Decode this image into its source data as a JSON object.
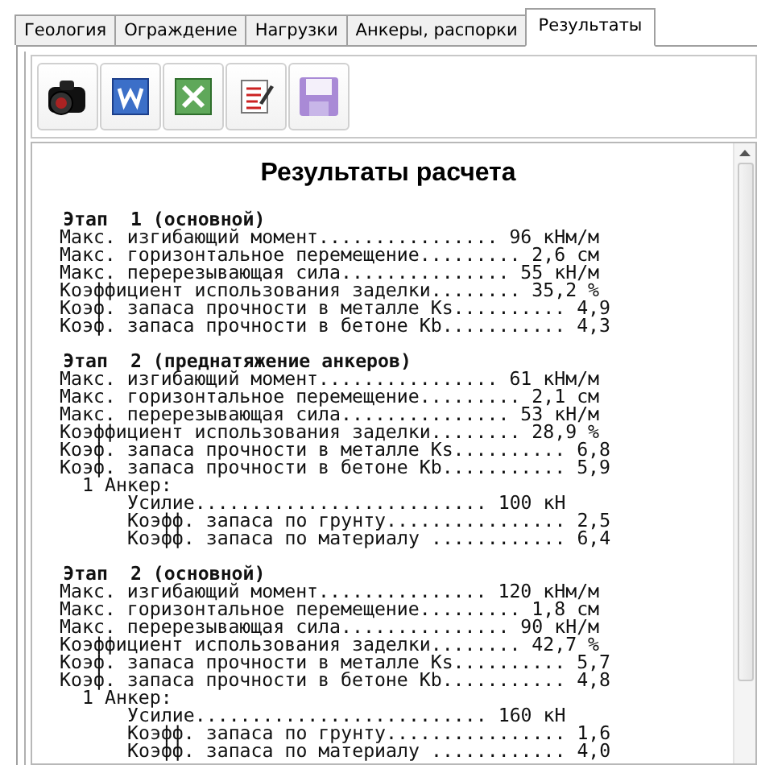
{
  "tabs": [
    {
      "label": "Геология",
      "selected": false
    },
    {
      "label": "Ограждение",
      "selected": false
    },
    {
      "label": "Нагрузки",
      "selected": false
    },
    {
      "label": "Анкеры, распорки",
      "selected": false
    },
    {
      "label": "Результаты",
      "selected": true
    }
  ],
  "toolbar": [
    {
      "kind": "camera"
    },
    {
      "kind": "word"
    },
    {
      "kind": "excel"
    },
    {
      "kind": "edit"
    },
    {
      "kind": "save"
    }
  ],
  "report": {
    "title": "Результаты расчета",
    "stages": [
      {
        "header": "Этап  1 (основной)",
        "lines": [
          "Макс. изгибающий момент................ 96 кНм/м",
          "Макс. горизонтальное перемещение......... 2,6 см",
          "Макс. перерезывающая сила............... 55 кН/м",
          "Коэффициент использования заделки........ 35,2 %",
          "Коэф. запаса прочности в металле Ks.......... 4,9",
          "Коэф. запаса прочности в бетоне Kb........... 4,3"
        ]
      },
      {
        "header": "Этап  2 (преднатяжение анкеров)",
        "lines": [
          "Макс. изгибающий момент................ 61 кНм/м",
          "Макс. горизонтальное перемещение......... 2,1 см",
          "Макс. перерезывающая сила............... 53 кН/м",
          "Коэффициент использования заделки........ 28,9 %",
          "Коэф. запаса прочности в металле Ks.......... 6,8",
          "Коэф. запаса прочности в бетоне Kb........... 5,9"
        ],
        "anchors": [
          {
            "label": "1 Анкер:",
            "lines": [
              "Усилие.......................... 100 кН",
              "Коэфф. запаса по грунту................ 2,5",
              "Коэфф. запаса по материалу ............ 6,4"
            ]
          }
        ]
      },
      {
        "header": "Этап  2 (основной)",
        "lines": [
          "Макс. изгибающий момент............... 120 кНм/м",
          "Макс. горизонтальное перемещение......... 1,8 см",
          "Макс. перерезывающая сила............... 90 кН/м",
          "Коэффициент использования заделки........ 42,7 %",
          "Коэф. запаса прочности в металле Ks.......... 5,7",
          "Коэф. запаса прочности в бетоне Kb........... 4,8"
        ],
        "anchors": [
          {
            "label": "1 Анкер:",
            "lines": [
              "Усилие.......................... 160 кН",
              "Коэфф. запаса по грунту................ 1,6",
              "Коэфф. запаса по материалу ............ 4,0"
            ]
          }
        ]
      }
    ]
  }
}
